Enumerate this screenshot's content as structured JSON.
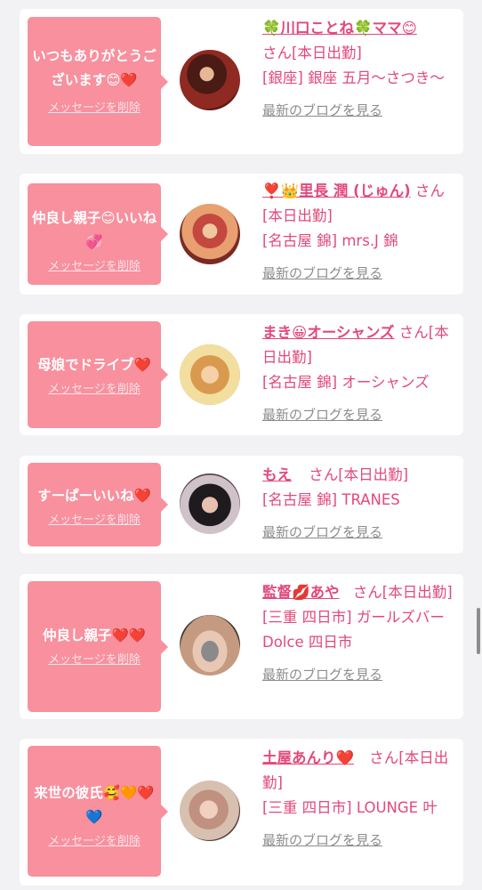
{
  "cards": [
    {
      "message": "いつもありがとうございます😊❤️",
      "delete_label": "メッセージを削除",
      "name": "🍀川口ことね🍀ママ😊",
      "suffix": "さん[本日出勤]",
      "shop": "[銀座] 銀座 五月〜さつき〜",
      "blog_label": "最新のブログを見る"
    },
    {
      "message": "仲良し親子😊いいね💞",
      "delete_label": "メッセージを削除",
      "name": "❣️👑里長 潤 (じゅん)",
      "suffix": "さん[本日出勤]",
      "shop": "[名古屋 錦] mrs.J 錦",
      "blog_label": "最新のブログを見る"
    },
    {
      "message": "母娘でドライブ❤️",
      "delete_label": "メッセージを削除",
      "name": "まき😀オーシャンズ",
      "suffix": "さん[本日出勤]",
      "shop": "[名古屋 錦] オーシャンズ",
      "blog_label": "最新のブログを見る"
    },
    {
      "message": "すーぱーいいね❤️",
      "delete_label": "メッセージを削除",
      "name": "もえ",
      "suffix": "さん[本日出勤]",
      "shop": "[名古屋 錦] TRANES",
      "blog_label": "最新のブログを見る"
    },
    {
      "message": "仲良し親子❤️❤️",
      "delete_label": "メッセージを削除",
      "name": "監督💋あや",
      "suffix": "さん[本日出勤]",
      "shop": "[三重 四日市] ガールズバー Dolce 四日市",
      "blog_label": "最新のブログを見る"
    },
    {
      "message": "来世の彼氏🥰🧡❤️💙",
      "delete_label": "メッセージを削除",
      "name": "土屋あんり❤️",
      "suffix": "さん[本日出勤]",
      "shop": "[三重 四日市] LOUNGE 叶",
      "blog_label": "最新のブログを見る"
    }
  ],
  "colors": {
    "accent": "#e2497a",
    "bubble": "#f8909e",
    "link_gray": "#8c8c8c"
  }
}
